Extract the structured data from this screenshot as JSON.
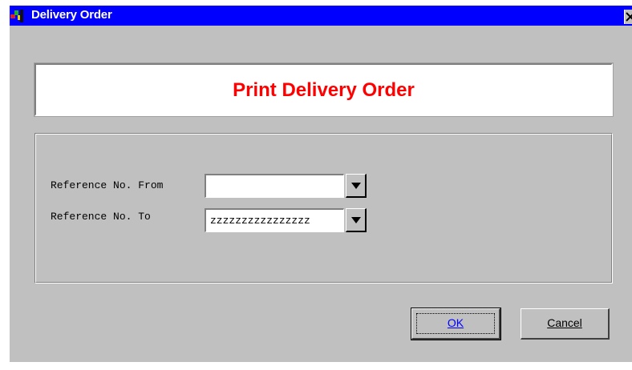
{
  "window": {
    "title": "Delivery Order",
    "title_bar_color": "#0000ff",
    "icons": {
      "app": "delivery-order-app-icon",
      "close": "close-icon"
    }
  },
  "header": {
    "title": "Print Delivery Order",
    "title_color": "#ff0000"
  },
  "form": {
    "from_label": "Reference No. From",
    "from_value": "",
    "to_label": "Reference No. To",
    "to_value": "zzzzzzzzzzzzzzzz",
    "dropdown_icon": "triangle-down-icon"
  },
  "buttons": {
    "ok_label": "OK",
    "cancel_label": "Cancel"
  }
}
